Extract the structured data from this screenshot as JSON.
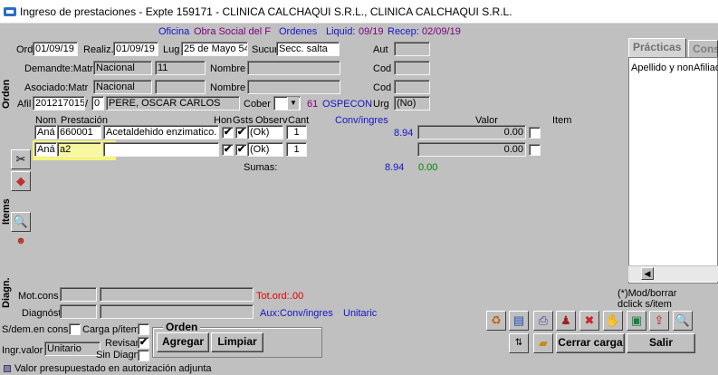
{
  "window": {
    "title": "Ingreso de prestaciones - Expte 159171 - CLINICA CALCHAQUI S.R.L., CLINICA CALCHAQUI S.R.L."
  },
  "header": {
    "oficina_label": "Oficina",
    "obra_social": "Obra Social del F",
    "ordenes_label": "Ordenes",
    "liquid_label": "Liquid:",
    "liquid_value": "09/19",
    "recep_label": "Recep:",
    "recep_value": "02/09/19"
  },
  "orden": {
    "section_label": "Orden",
    "ord_label": "Ord",
    "ord_value": "01/09/19",
    "realiz_label": "Realiz.",
    "realiz_value": "01/09/19",
    "lug_label": "Lug",
    "lug_value": "25 de Mayo 54",
    "sucur_label": "Sucur",
    "sucur_value": "Secc. salta",
    "aut_label": "Aut",
    "demandte_label": "Demandte:Matr",
    "demandte_matr": "Nacional",
    "demandte_num": "11",
    "nombre_label": "Nombre",
    "cod_label": "Cod",
    "asociado_label": "Asociado:Matr",
    "asociado_matr": "Nacional",
    "afil_label": "Afil",
    "afil_value": "201217015",
    "afil_sep": "/",
    "afil_sub": "0",
    "afil_name": "PERE, OSCAR CARLOS",
    "cober_label": "Cober",
    "cober_code": "61",
    "cober_name": "OSPECON",
    "urg_label": "Urg",
    "urg_value": "(No)"
  },
  "items": {
    "section_label": "Items",
    "headers": {
      "nom": "Nom",
      "prestacion": "Prestación",
      "hon": "Hon",
      "gsts": "Gsts",
      "observ": "Observ",
      "cant": "Cant",
      "conv": "Conv/ingres",
      "valor": "Valor",
      "item": "Item"
    },
    "rows": [
      {
        "nom": "Aná",
        "code": "660001",
        "desc": "Acetaldehido enzimatico.",
        "hon": "✔",
        "gsts": "✔",
        "observ": "(Ok)",
        "cant": "1",
        "conv": "8.94",
        "valor": "0.00"
      },
      {
        "nom": "Aná",
        "code": "a2",
        "desc": "",
        "hon": "✔",
        "gsts": "✔",
        "observ": "(Ok)",
        "cant": "1",
        "conv": "",
        "valor": "0.00"
      }
    ],
    "sumas_label": "Sumas:",
    "sumas_conv": "8.94",
    "sumas_valor": "0.00"
  },
  "diagn": {
    "section_label": "Diagn.",
    "motcons_label": "Mot.cons",
    "totord_label": "Tot.ord:",
    "totord_value": ".00",
    "diagnost_label": "Diagnóst",
    "aux_conv": "Aux:Conv/ingres",
    "unitaric": "Unitaric"
  },
  "bottom": {
    "sdem_label": "S/dem.en cons",
    "carga_label": "Carga p/item",
    "ingr_label": "Ingr.valor",
    "ingr_value": "Unitario",
    "revisar_label": "Revisar",
    "revisar_check": "✔",
    "sindiagn_label": "Sin Diagn",
    "orden_group": "Orden",
    "agregar": "Agregar",
    "limpiar": "Limpiar",
    "status": "Valor presupuestado en autorización adjunta"
  },
  "side_panel": {
    "tab_practicas": "Prácticas",
    "tab_cons": "Cons",
    "col_apellido": "Apellido y nom",
    "col_afiliado": "Afiliado",
    "mod_hint_1": "(*)Mod/borrar",
    "mod_hint_2": "dclick s/item"
  },
  "actions": {
    "cerrar_carga": "Cerrar carga",
    "salir": "Salir"
  }
}
